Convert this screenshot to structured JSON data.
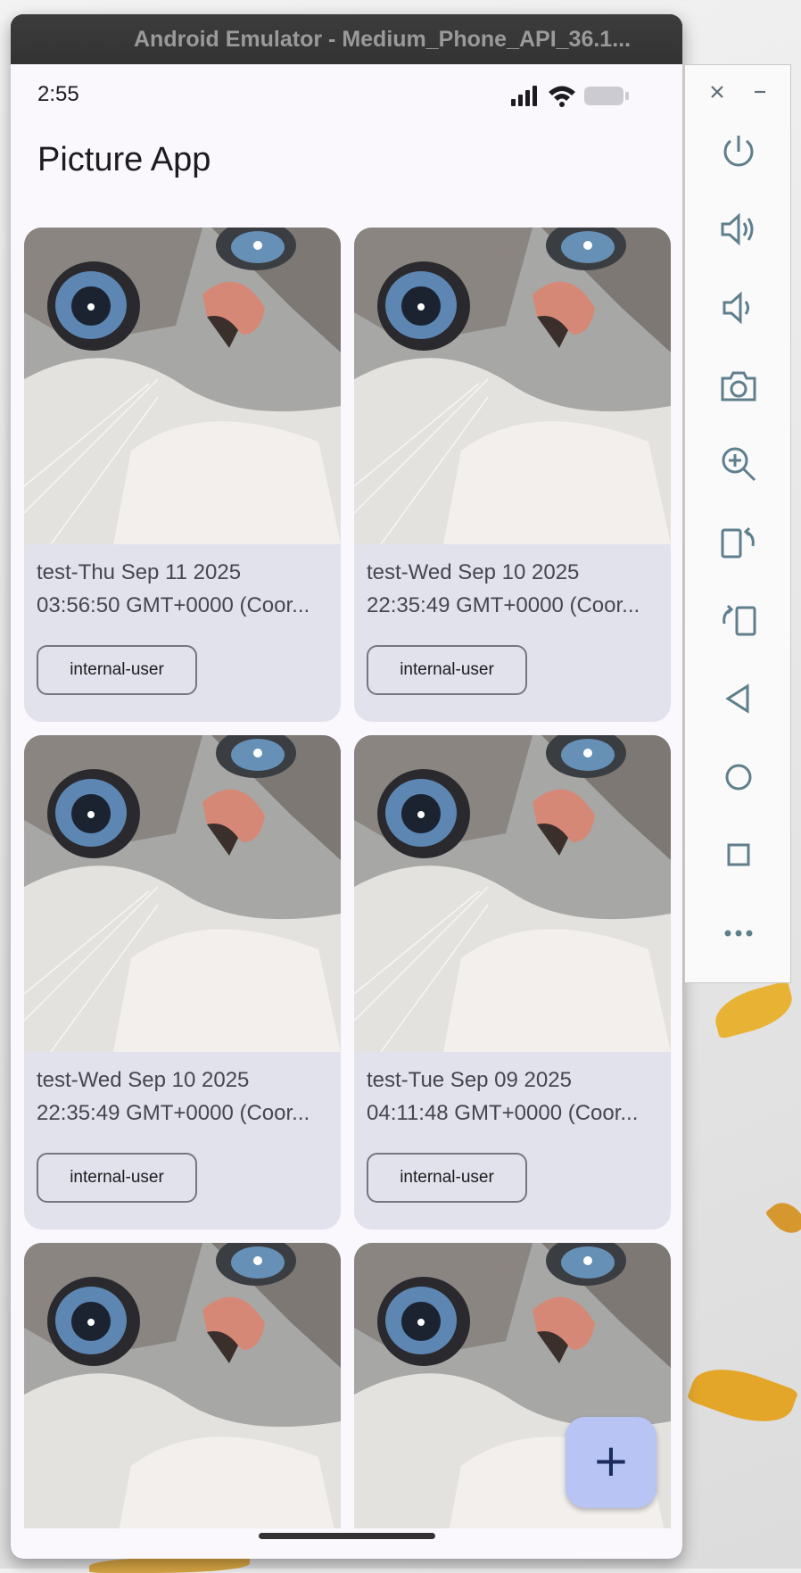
{
  "window": {
    "title": "Android Emulator - Medium_Phone_API_36.1..."
  },
  "status_bar": {
    "time": "2:55",
    "icons": [
      "signal-icon",
      "wifi-icon",
      "battery-icon"
    ]
  },
  "app": {
    "title": "Picture App",
    "accent_color": "#b7c4f4",
    "card_color": "#e2e2ec",
    "fab_label": "+"
  },
  "cards": [
    {
      "line1": "test-Thu Sep 11 2025",
      "line2": "03:56:50 GMT+0000 (Coor...",
      "chip": "internal-user"
    },
    {
      "line1": "test-Wed Sep 10 2025",
      "line2": "22:35:49 GMT+0000 (Coor...",
      "chip": "internal-user"
    },
    {
      "line1": "test-Wed Sep 10 2025",
      "line2": "22:35:49 GMT+0000 (Coor...",
      "chip": "internal-user"
    },
    {
      "line1": "test-Tue Sep 09 2025",
      "line2": "04:11:48 GMT+0000 (Coor...",
      "chip": "internal-user"
    }
  ],
  "emulator_toolbar": {
    "items": [
      "close-icon",
      "minimize-icon",
      "power-icon",
      "volume-up-icon",
      "volume-down-icon",
      "camera-icon",
      "zoom-icon",
      "rotate-left-icon",
      "rotate-right-icon",
      "back-icon",
      "home-icon",
      "overview-icon",
      "more-icon"
    ]
  }
}
